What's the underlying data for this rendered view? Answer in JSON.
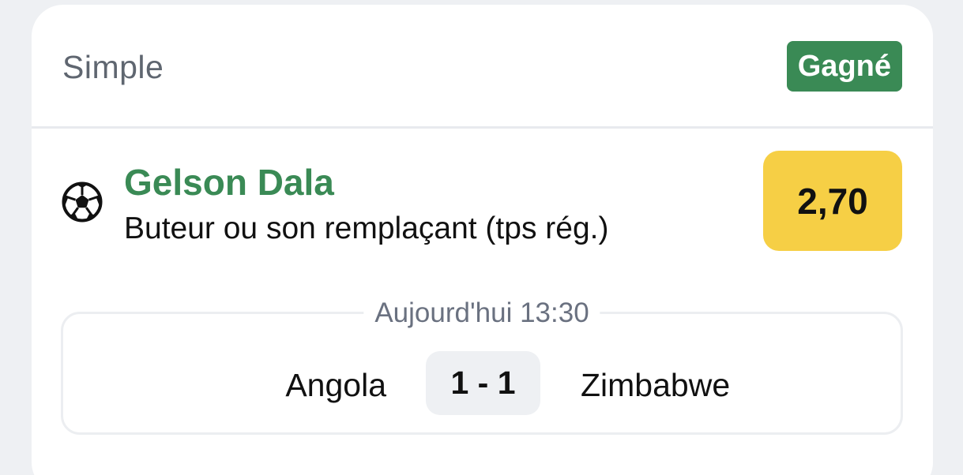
{
  "bet": {
    "type": "Simple",
    "status": "Gagné"
  },
  "selection": {
    "sport_icon": "soccer-ball-icon",
    "player": "Gelson Dala",
    "market": "Buteur ou son remplaçant (tps rég.)",
    "odds": "2,70"
  },
  "match": {
    "time": "Aujourd'hui 13:30",
    "home_team": "Angola",
    "score": "1 - 1",
    "away_team": "Zimbabwe"
  },
  "colors": {
    "won_green": "#3a8a55",
    "odds_yellow": "#f6cf45",
    "page_bg": "#eef0f3"
  }
}
